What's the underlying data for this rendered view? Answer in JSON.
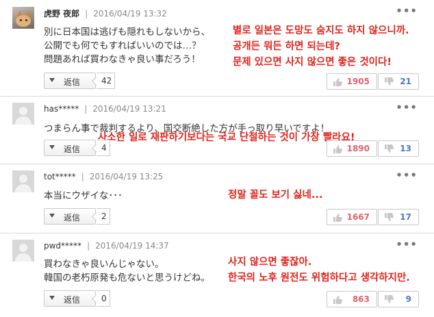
{
  "comments": [
    {
      "author": "虎野 夜郎",
      "separator": "|",
      "time": "2016/04/19 13:32",
      "more_label": "•••",
      "lines": [
        "別に日本国は逃げも隠れもしないから、",
        "公開でも何でもすればいいのでは…？",
        "問題あれば買わなきゃ良い事だろう！"
      ],
      "overlay": [
        "별로 일본은 도망도 숨지도 하지 않으니까.",
        "공개든 뭐든 하면 되는데?",
        "문제 있으면 사지 않으면 좋은 것이다!"
      ],
      "reply_label": "返信",
      "reply_count": "42",
      "good": "1905",
      "bad": "21"
    },
    {
      "author": "has*****",
      "separator": "|",
      "time": "2016/04/19 13:21",
      "more_label": "•••",
      "lines": [
        "つまらん事で裁判するより、国交断絶した方が手っ取り早いですよ！"
      ],
      "overlay": [
        "사소한 일로 재판하기보다는 국교 단절하는 것이 가장 빨라요!"
      ],
      "reply_label": "返信",
      "reply_count": "4",
      "good": "1890",
      "bad": "13"
    },
    {
      "author": "tot*****",
      "separator": "|",
      "time": "2016/04/19 13:25",
      "more_label": "•••",
      "lines": [
        "本当にウザイな･･･"
      ],
      "overlay": [
        "정말 꼴도 보기 싫네..."
      ],
      "reply_label": "返信",
      "reply_count": "2",
      "good": "1667",
      "bad": "17"
    },
    {
      "author": "pwd*****",
      "separator": "|",
      "time": "2016/04/19 14:37",
      "more_label": "•••",
      "lines": [
        "買わなきゃ良いんじゃない。",
        "韓国の老朽原発も危ないと思うけどね。"
      ],
      "overlay": [
        "사지 않으면 좋잖아.",
        "한국의 노후 원전도 위험하다고 생각하지만."
      ],
      "reply_label": "返信",
      "reply_count": "0",
      "good": "863",
      "bad": "9"
    }
  ],
  "icons": {
    "good": "thumbs-up-icon",
    "bad": "thumbs-down-icon",
    "reply": "triangle-down-icon"
  },
  "colors": {
    "overlay_text": "#e0221a",
    "good_count": "#e0616b",
    "bad_count": "#4a78c2",
    "separator": "#d9d9d9"
  }
}
